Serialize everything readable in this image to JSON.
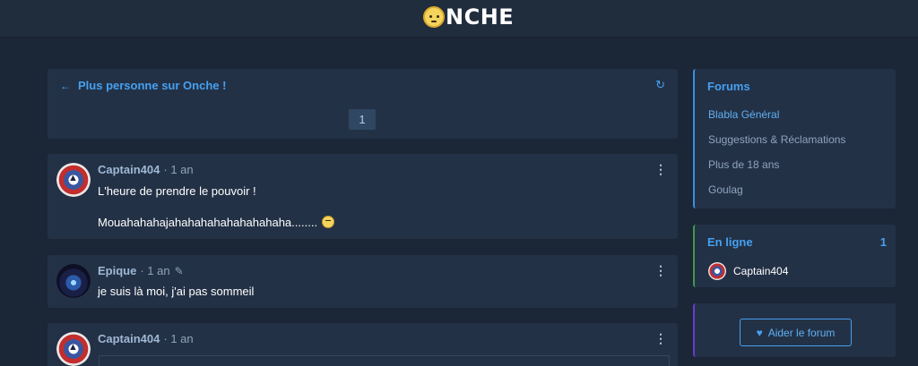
{
  "header": {
    "logo_text": "NCHE",
    "logo_icon": "smiley-icon"
  },
  "topic": {
    "back_label": "Plus personne sur Onche !",
    "refresh_icon": "refresh-icon",
    "current_page": "1"
  },
  "posts": [
    {
      "author": "Captain404",
      "meta": "· 1 an",
      "lines": [
        "L'heure de prendre le pouvoir !",
        "Mouahahahajahahahahahahahahaha........"
      ],
      "edited": false
    },
    {
      "author": "Epique",
      "meta": "· 1 an",
      "lines": [
        "je suis là moi, j'ai pas sommeil"
      ],
      "edited": true
    },
    {
      "author": "Captain404",
      "meta": "· 1 an",
      "lines": [],
      "edited": false
    }
  ],
  "sidebar": {
    "forums_title": "Forums",
    "forums": [
      "Blabla Général",
      "Suggestions & Réclamations",
      "Plus de 18 ans",
      "Goulag"
    ],
    "online_title": "En ligne",
    "online_count": "1",
    "online_users": [
      "Captain404"
    ],
    "support_label": "Aider le forum"
  },
  "colors": {
    "background": "#1b2636",
    "card": "#233146",
    "accent": "#46a0f0",
    "online_border": "#3e9a4c",
    "support_border": "#6a3ad0"
  }
}
